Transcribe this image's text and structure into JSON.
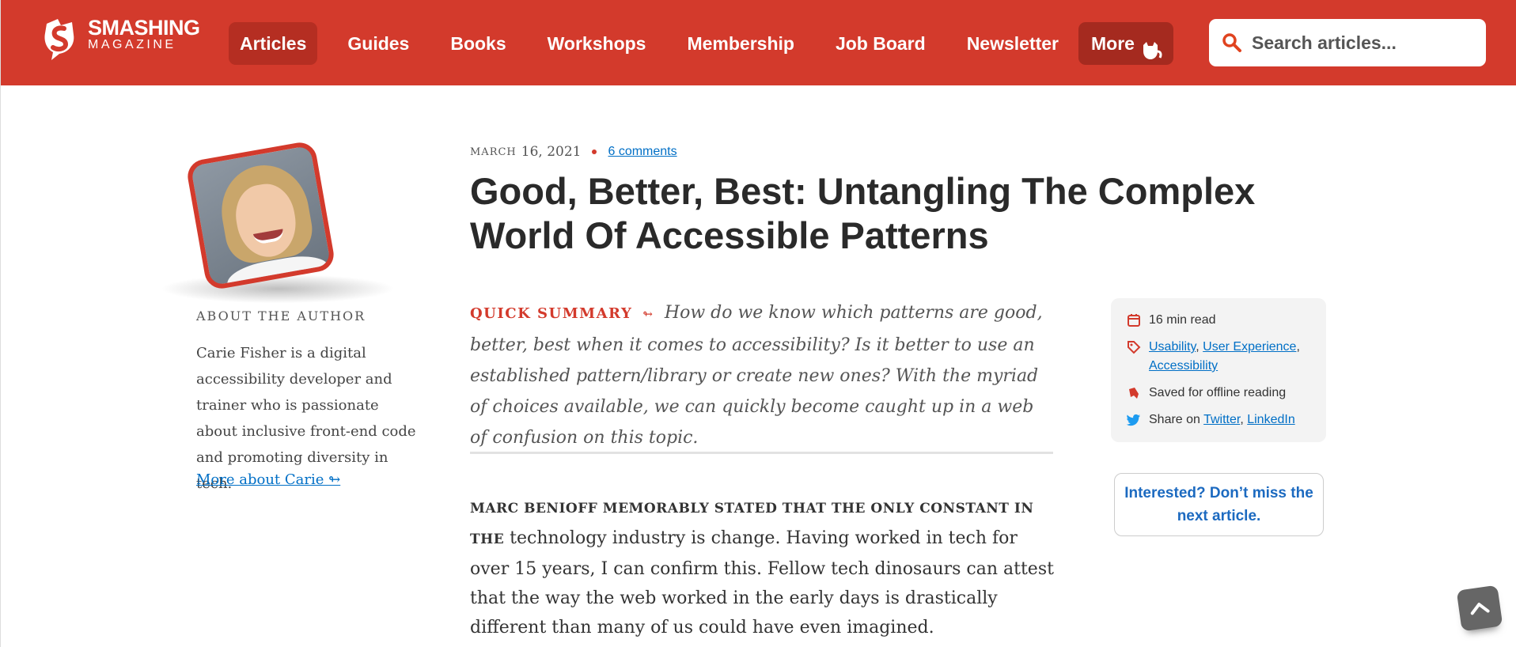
{
  "header": {
    "logo_line1": "SMASHING",
    "logo_line2": "MAGAZINE",
    "nav": [
      {
        "label": "Articles"
      },
      {
        "label": "Guides"
      },
      {
        "label": "Books"
      },
      {
        "label": "Workshops"
      },
      {
        "label": "Membership"
      },
      {
        "label": "Job Board"
      },
      {
        "label": "Newsletter"
      }
    ],
    "more_label": "More",
    "search_placeholder": "Search articles...",
    "brand_color": "#d33a2c"
  },
  "author": {
    "about_label": "ABOUT THE AUTHOR",
    "bio": "Carie Fisher is a digital accessibility developer and trainer who is passionate about inclusive front-end code and promoting diversity in tech.",
    "more_link": "More about Carie ↬"
  },
  "article": {
    "date_month": "MARCH",
    "date_rest": "16, 2021",
    "comments": "6 comments",
    "title": "Good, Better, Best: Untangling The Complex World Of Accessible Patterns",
    "summary_label": "QUICK SUMMARY",
    "summary_arrow": "↬",
    "summary": "How do we know which patterns are good, better, best when it comes to accessibility? Is it better to use an established pattern/library or create new ones? With the myriad of choices available, we can quickly become caught up in a web of confusion on this topic.",
    "lead": "MARC BENIOFF MEMORABLY STATED THAT THE ONLY CONSTANT IN THE",
    "body": "technology industry is change. Having worked in tech for over 15 years, I can confirm this. Fellow tech dinosaurs can attest that the way the web worked in the early days is drastically different than many of us could have even imagined."
  },
  "sidebar": {
    "read_time": "16 min read",
    "tags": [
      "Usability",
      "User Experience",
      "Accessibility"
    ],
    "offline": "Saved for offline reading",
    "share_prefix": "Share on",
    "share_twitter": "Twitter",
    "share_linkedin": "LinkedIn",
    "newsletter_cta": "Interested? Don’t miss the next article."
  }
}
